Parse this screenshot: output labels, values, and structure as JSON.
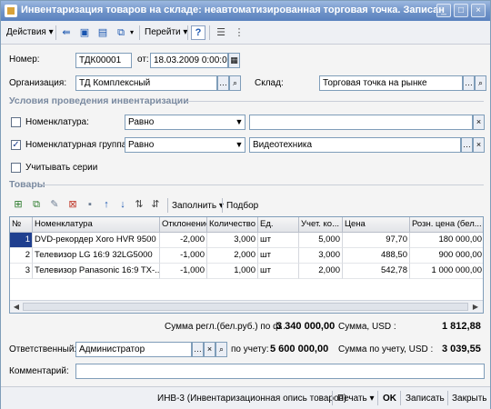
{
  "window": {
    "title": "Инвентаризация товаров на складе: неавтоматизированная торговая точка. Записан",
    "controls": [
      "_",
      "□",
      "×"
    ]
  },
  "toolbar": {
    "actions_label": "Действия",
    "goto_label": "Перейти",
    "help_label": "?",
    "icons": [
      "arrow-left-icon",
      "copy-icon",
      "save-icon",
      "structure-icon",
      "list-icon",
      "tree-icon"
    ]
  },
  "form": {
    "number_label": "Номер:",
    "number_value": "ТДК00001",
    "from_label": "от:",
    "date_value": "18.03.2009  0:00:00",
    "org_label": "Организация:",
    "org_value": "ТД Комплексный",
    "warehouse_label": "Склад:",
    "warehouse_value": "Торговая точка на рынке"
  },
  "conditions": {
    "title": "Условия проведения инвентаризации",
    "rows": [
      {
        "checked": false,
        "label": "Номенклатура:",
        "op": "Равно",
        "value": ""
      },
      {
        "checked": true,
        "label": "Номенклатурная группа:",
        "op": "Равно",
        "value": "Видеотехника"
      }
    ],
    "series_label": "Учитывать серии",
    "series_checked": false
  },
  "goods": {
    "title": "Товары",
    "fill_label": "Заполнить",
    "selection_label": "Подбор",
    "columns": [
      "№",
      "Номенклатура",
      "Отклонение",
      "Количество",
      "Ед.",
      "Учет. ко...",
      "Цена",
      "Розн. цена (бел..."
    ],
    "rows": [
      [
        "1",
        "DVD-рекордер Xoro HVR 9500",
        "-2,000",
        "3,000",
        "шт",
        "5,000",
        "97,70",
        "180 000,00"
      ],
      [
        "2",
        "Телевизор LG 16:9 32LG5000",
        "-1,000",
        "2,000",
        "шт",
        "3,000",
        "488,50",
        "900 000,00"
      ],
      [
        "3",
        "Телевизор Panasonic 16:9 TX-...",
        "-1,000",
        "1,000",
        "шт",
        "2,000",
        "542,78",
        "1 000 000,00"
      ]
    ]
  },
  "totals": {
    "sum_label": "Сумма регл.(бел.руб.) по ф...",
    "sum_value": "3 340 000,00",
    "sum_usd_label": "Сумма, USD :",
    "sum_usd_value": "1 812,88",
    "acc_label": "по учету:",
    "acc_value": "5 600 000,00",
    "acc_usd_label": "Сумма по учету, USD :",
    "acc_usd_value": "3 039,55"
  },
  "responsible": {
    "label": "Ответственный:",
    "value": "Администратор"
  },
  "comment": {
    "label": "Комментарий:",
    "value": ""
  },
  "bottombar": {
    "report_label": "ИНВ-3 (Инвентаризационная опись товаров)",
    "print_label": "Печать",
    "ok_label": "OK",
    "record_label": "Записать",
    "close_label": "Закрыть"
  }
}
